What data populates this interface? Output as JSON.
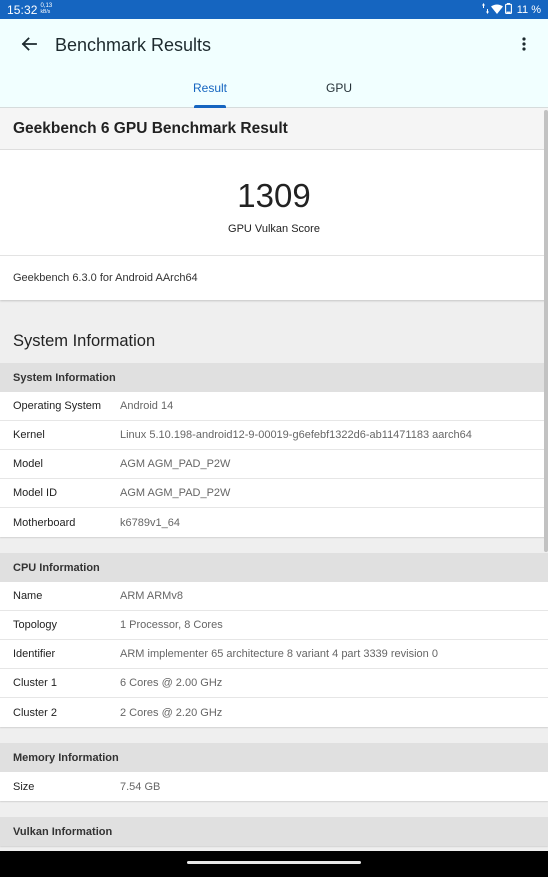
{
  "status_bar": {
    "time": "15:32",
    "net_speed_value": "0,13",
    "net_speed_unit": "kB/s",
    "battery": "11 %"
  },
  "app_bar": {
    "title": "Benchmark Results",
    "tabs": [
      {
        "label": "Result",
        "selected": true
      },
      {
        "label": "GPU",
        "selected": false
      }
    ],
    "accent_color": "#1565c0"
  },
  "result": {
    "title": "Geekbench 6 GPU Benchmark Result",
    "score": "1309",
    "score_label": "GPU Vulkan Score",
    "version": "Geekbench 6.3.0 for Android AArch64"
  },
  "system_information": {
    "title": "System Information",
    "groups": [
      {
        "header": "System Information",
        "rows": [
          {
            "key": "Operating System",
            "value": "Android 14"
          },
          {
            "key": "Kernel",
            "value": "Linux 5.10.198-android12-9-00019-g6efebf1322d6-ab11471183 aarch64"
          },
          {
            "key": "Model",
            "value": "AGM AGM_PAD_P2W"
          },
          {
            "key": "Model ID",
            "value": "AGM AGM_PAD_P2W"
          },
          {
            "key": "Motherboard",
            "value": "k6789v1_64"
          }
        ]
      },
      {
        "header": "CPU Information",
        "rows": [
          {
            "key": "Name",
            "value": "ARM ARMv8"
          },
          {
            "key": "Topology",
            "value": "1 Processor, 8 Cores"
          },
          {
            "key": "Identifier",
            "value": "ARM implementer 65 architecture 8 variant 4 part 3339 revision 0"
          },
          {
            "key": "Cluster 1",
            "value": "6 Cores @ 2.00 GHz"
          },
          {
            "key": "Cluster 2",
            "value": "2 Cores @ 2.20 GHz"
          }
        ]
      },
      {
        "header": "Memory Information",
        "rows": [
          {
            "key": "Size",
            "value": "7.54 GB"
          }
        ]
      },
      {
        "header": "Vulkan Information",
        "rows": []
      }
    ]
  }
}
